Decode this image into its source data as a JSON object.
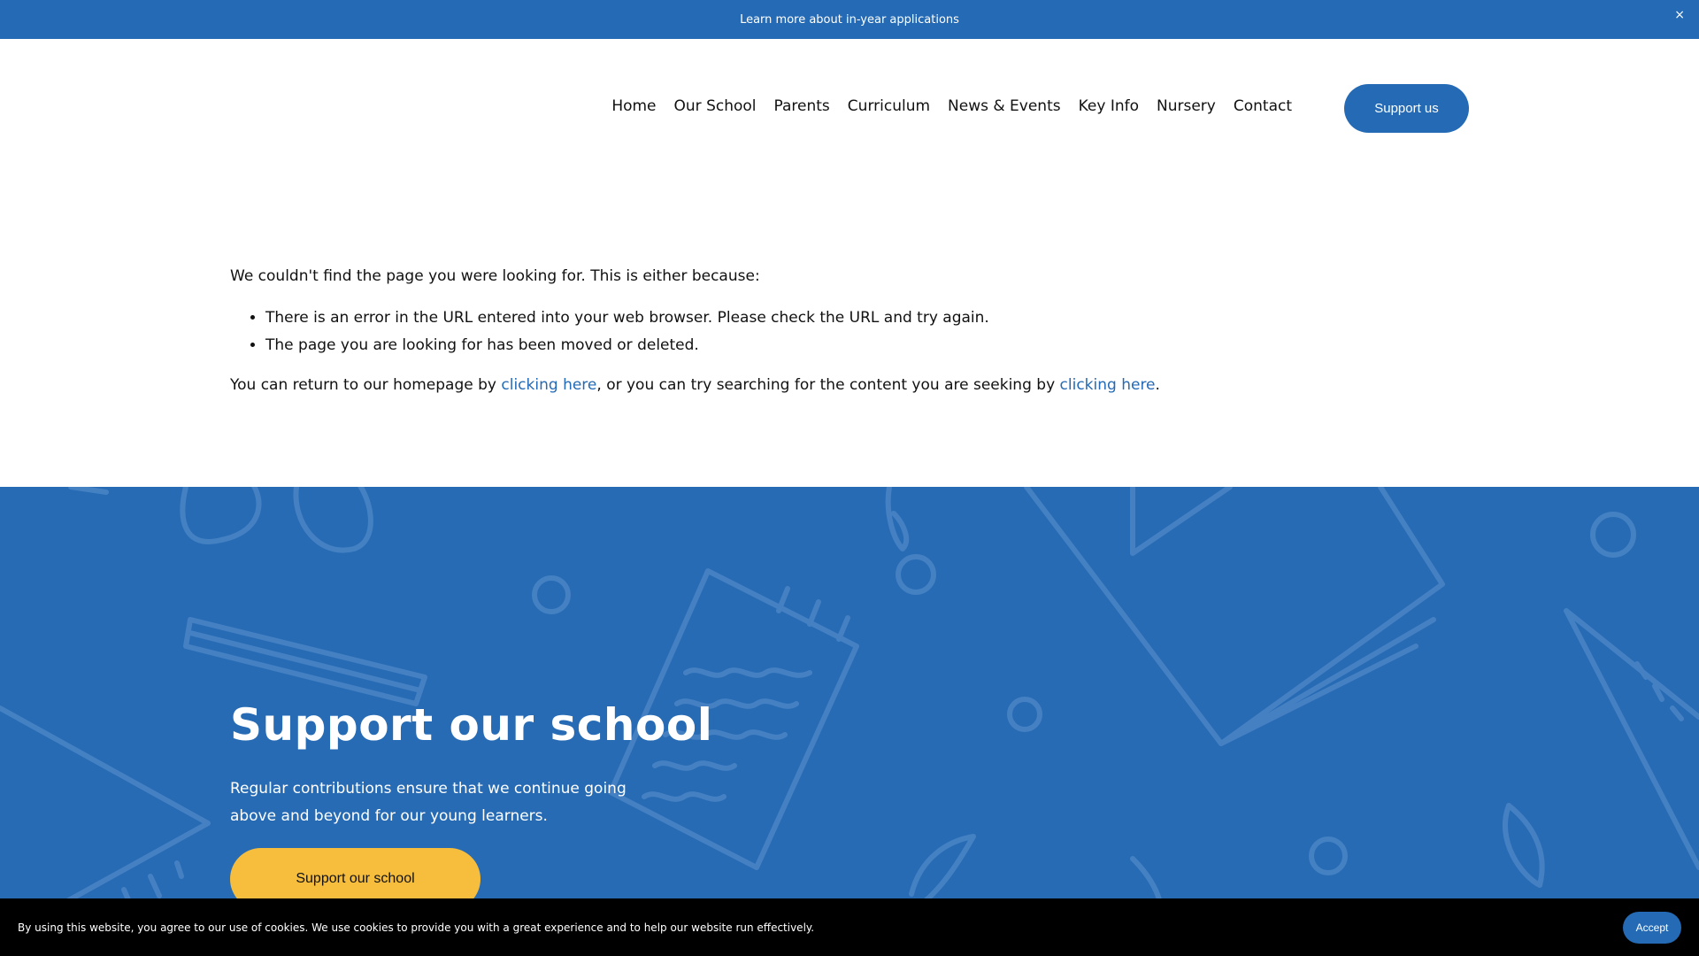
{
  "announcement": {
    "text": "Learn more about in-year applications",
    "close": "×"
  },
  "nav": {
    "items": [
      {
        "label": "Home"
      },
      {
        "label": "Our School"
      },
      {
        "label": "Parents"
      },
      {
        "label": "Curriculum"
      },
      {
        "label": "News & Events"
      },
      {
        "label": "Key Info"
      },
      {
        "label": "Nursery"
      },
      {
        "label": "Contact"
      }
    ],
    "support_button": "Support us"
  },
  "error_page": {
    "intro": "We couldn't find the page you were looking for. This is either because:",
    "reasons": [
      "There is an error in the URL entered into your web browser. Please check the URL and try again.",
      "The page you are looking for has been moved or deleted."
    ],
    "return_prefix": "You can return to our homepage by ",
    "homepage_link": "clicking here",
    "return_middle": ", or you can try searching for the content you are seeking by ",
    "search_link": "clicking here",
    "return_suffix": "."
  },
  "promo": {
    "title": "Support our school",
    "text": "Regular contributions ensure that we continue going above and beyond for our young learners.",
    "button": "Support our school",
    "background_color": "#276bb5",
    "button_color": "#f7bd3c"
  },
  "cookie": {
    "message": "By using this website, you agree to our use of cookies. We use cookies to provide you with a great experience and to help our website run effectively.",
    "accept": "Accept"
  },
  "colors": {
    "accent": "#246ab5",
    "cookie_bar": "#000000"
  }
}
